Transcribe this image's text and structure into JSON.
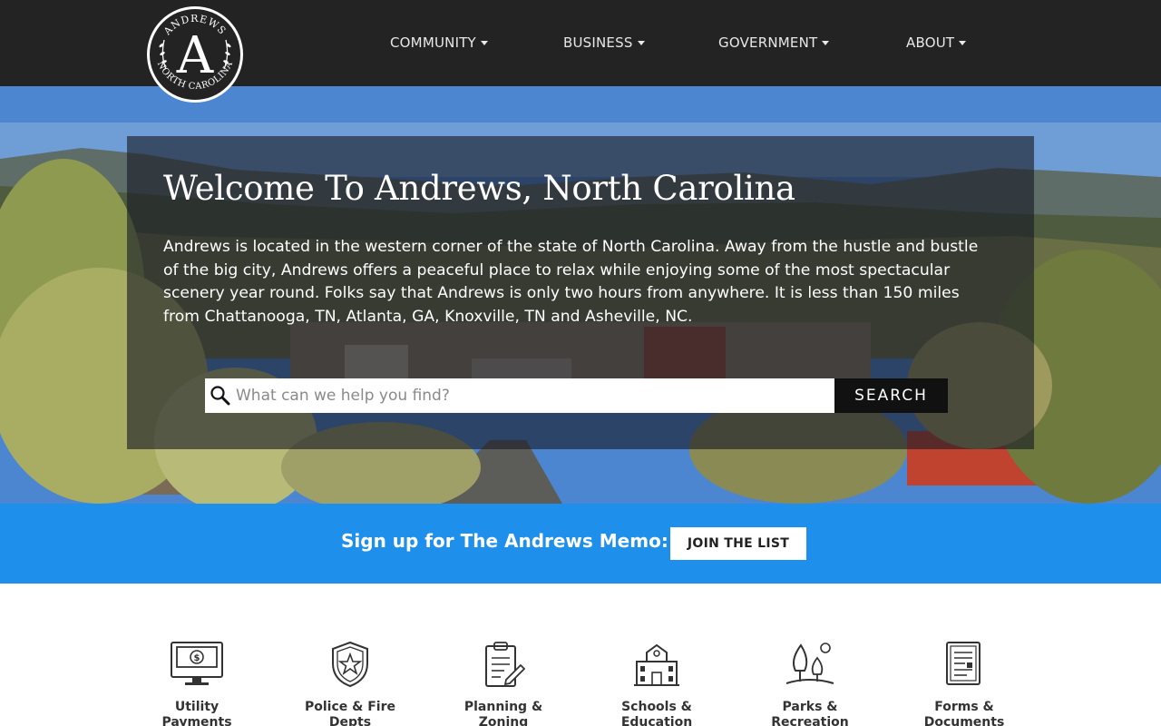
{
  "header": {
    "logo": {
      "top_text": "ANDREWS",
      "letter": "A",
      "bottom_text": "NORTH CAROLINA"
    },
    "nav": [
      {
        "label": "COMMUNITY"
      },
      {
        "label": "BUSINESS"
      },
      {
        "label": "GOVERNMENT"
      },
      {
        "label": "ABOUT"
      }
    ]
  },
  "hero": {
    "title": "Welcome To Andrews, North Carolina",
    "text": "Andrews is located in the western corner of the state of North Carolina. Away from the hustle and bustle of the big city, Andrews offers a peaceful place to relax while enjoying some of the most spectacular scenery year round. Folks say that Andrews is only two hours from anywhere. It is less than 150 miles from Chattanooga, TN, Atlanta, GA, Knoxville, TN and Asheville, NC.",
    "search": {
      "placeholder": "What can we help you find?",
      "value": "",
      "button": "SEARCH"
    }
  },
  "memo": {
    "text": "Sign up for The Andrews Memo:",
    "button": "JOIN THE LIST"
  },
  "quick_links": [
    {
      "label": "Utility\nPayments",
      "icon": "utility-payments-icon"
    },
    {
      "label": "Police & Fire\nDepts",
      "icon": "police-badge-icon"
    },
    {
      "label": "Planning &\nZoning",
      "icon": "planning-clipboard-icon"
    },
    {
      "label": "Schools &\nEducation",
      "icon": "school-building-icon"
    },
    {
      "label": "Parks &\nRecreation",
      "icon": "park-trees-icon"
    },
    {
      "label": "Forms &\nDocuments",
      "icon": "forms-documents-icon"
    }
  ],
  "colors": {
    "header_bg": "#232323",
    "memo_bg": "#1e8fea",
    "search_button_bg": "#111111"
  }
}
